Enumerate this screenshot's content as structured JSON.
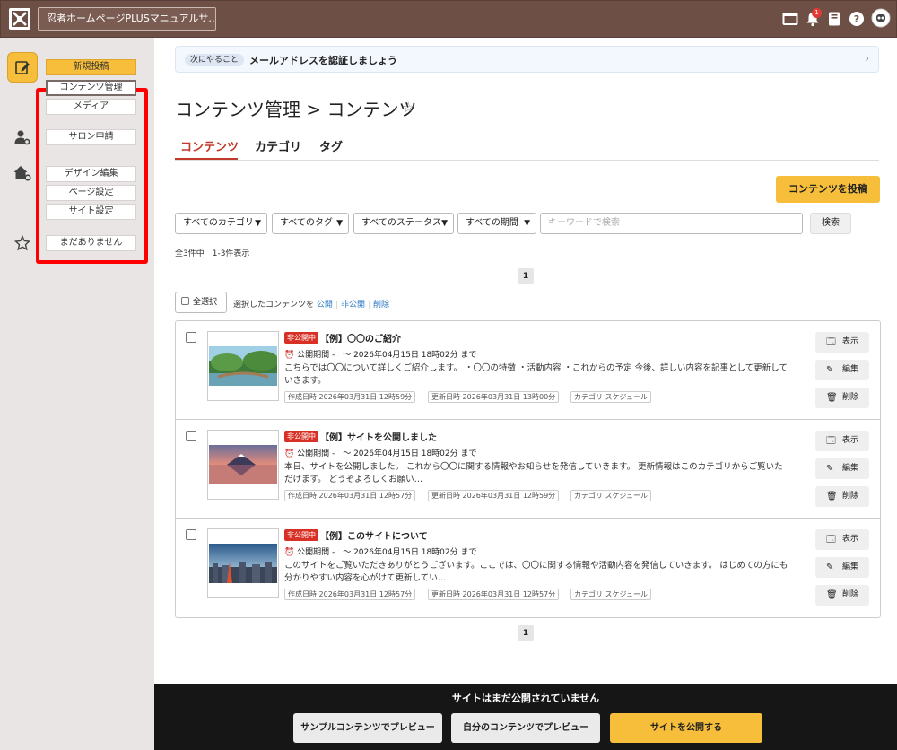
{
  "header": {
    "site_name": "忍者ホームページPLUSマニュアルサ…",
    "notification_count": "1"
  },
  "sidebar": {
    "menu": {
      "new_post": "新規投稿",
      "content_manage": "コンテンツ管理",
      "media": "メディア",
      "salon": "サロン申請",
      "design": "デザイン編集",
      "page_settings": "ページ設定",
      "site_settings": "サイト設定",
      "favorites_empty": "まだありません"
    }
  },
  "notice": {
    "tag": "次にやること",
    "text": "メールアドレスを認証しましょう"
  },
  "page": {
    "title": "コンテンツ管理 > コンテンツ"
  },
  "tabs": [
    "コンテンツ",
    "カテゴリ",
    "タグ"
  ],
  "toolbar": {
    "post_button": "コンテンツを投稿",
    "filters": [
      "すべてのカテゴリ",
      "すべてのタグ",
      "すべてのステータス",
      "すべての期間"
    ],
    "keyword_placeholder": "キーワードで検索",
    "search_button": "検索",
    "count_text": "全3件中　1-3件表示",
    "page_number": "1"
  },
  "bulk": {
    "select_all": "全選択",
    "prefix": "選択したコンテンツを",
    "publish": "公開",
    "unpublish": "非公開",
    "delete": "削除"
  },
  "items": [
    {
      "status": "非公開中",
      "title": "【例】〇〇のご紹介",
      "period": "公開期間 -　～ 2026年04月15日 18時02分 まで",
      "description": "こちらでは〇〇について詳しくご紹介します。 ・〇〇の特徴 ・活動内容 ・これからの予定 今後、詳しい内容を記事として更新していきます。",
      "created": "作成日時  2026年03月31日 12時59分",
      "updated": "更新日時  2026年03月31日 13時00分",
      "category": "カテゴリ  スケジュール"
    },
    {
      "status": "非公開中",
      "title": "【例】サイトを公開しました",
      "period": "公開期間 -　～ 2026年04月15日 18時02分 まで",
      "description": "本日、サイトを公開しました。 これから〇〇に関する情報やお知らせを発信していきます。 更新情報はこのカテゴリからご覧いただけます。 どうぞよろしくお願い…",
      "created": "作成日時  2026年03月31日 12時57分",
      "updated": "更新日時  2026年03月31日 12時59分",
      "category": "カテゴリ  スケジュール"
    },
    {
      "status": "非公開中",
      "title": "【例】このサイトについて",
      "period": "公開期間 -　～ 2026年04月15日 18時02分 まで",
      "description": "このサイトをご覧いただきありがとうございます。ここでは、〇〇に関する情報や活動内容を発信していきます。 はじめての方にも分かりやすい内容を心がけて更新してい…",
      "created": "作成日時  2026年03月31日 12時57分",
      "updated": "更新日時  2026年03月31日 12時57分",
      "category": "カテゴリ  スケジュール"
    }
  ],
  "actions": {
    "view": "表示",
    "edit": "編集",
    "delete": "削除"
  },
  "footer": {
    "message": "サイトはまだ公開されていません",
    "preview_sample": "サンプルコンテンツでプレビュー",
    "preview_own": "自分のコンテンツでプレビュー",
    "publish": "サイトを公開する"
  }
}
